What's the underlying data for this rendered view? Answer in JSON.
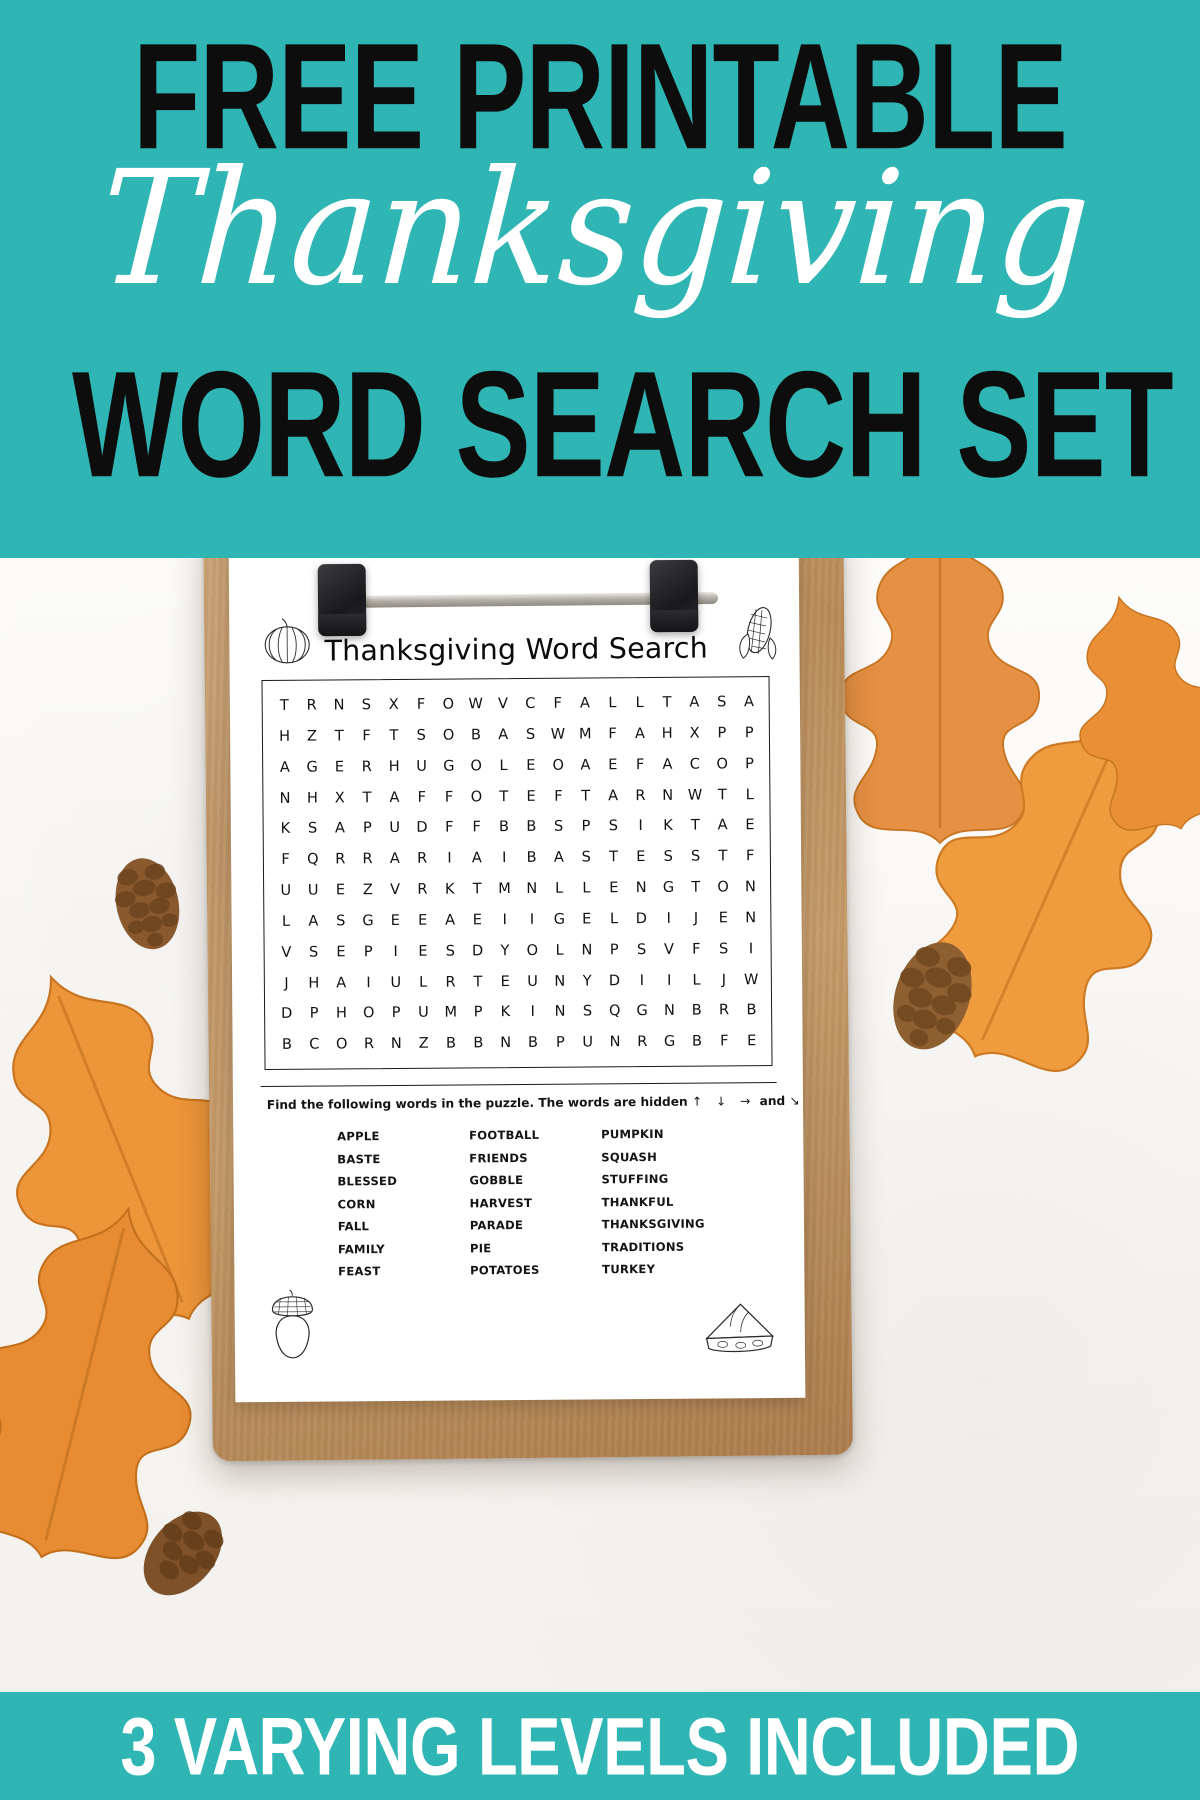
{
  "header": {
    "line1": "FREE PRINTABLE",
    "script": "Thanksgiving",
    "line3": "WORD SEARCH SET",
    "bg_color": "#2fb6b4",
    "text_color": "#0d0d0d",
    "script_color": "#ffffff"
  },
  "footer": {
    "text": "3 VARYING LEVELS INCLUDED",
    "bg_color": "#2fb6b4",
    "text_color": "#ffffff"
  },
  "worksheet": {
    "title": "Thanksgiving Word Search",
    "icons": {
      "left": "pumpkin-icon",
      "right": "corn-icon",
      "bottom_left": "acorn-icon",
      "bottom_right": "pie-slice-icon"
    },
    "instructions": {
      "text": "Find the following words in the puzzle. The words are hidden",
      "arrows": "↑  ↓  →",
      "conjunction": "and",
      "last_arrow": "↘"
    },
    "grid": {
      "columns": 15,
      "rows": 12,
      "letters": [
        "T R N S X F O W V C F A L L T",
        "H Z T F T S O B A S W M F A H X P P",
        "A G E R H U G O L E O A E F A C O P",
        "N H X T A F F O T E F T A R N W T L",
        "K S A P U D F F B B S P S I K T A E",
        "F Q R R A R I A I B A S T E S S T F",
        "U U E Z V R K T M N L L E N G T O N",
        "L A S G E E A E I I G E L D I J E N",
        "V S E P I E S D Y O L N P S V F S I",
        "J H A I U L R T E U N Y D I I L J W",
        "D P H O P U M P K I N S Q G N B R B",
        "B C O R N Z B B N B P U N R G B F E"
      ],
      "rows_data": [
        [
          "T",
          "R",
          "N",
          "S",
          "X",
          "F",
          "O",
          "W",
          "V",
          "C",
          "F",
          "A",
          "L",
          "L",
          "T"
        ],
        [
          "H",
          "Z",
          "T",
          "F",
          "T",
          "S",
          "O",
          "B",
          "A",
          "S",
          "W",
          "M",
          "F",
          "A",
          "H"
        ],
        [
          "A",
          "G",
          "E",
          "R",
          "H",
          "U",
          "G",
          "O",
          "L",
          "E",
          "O",
          "A",
          "E",
          "F",
          "A"
        ],
        [
          "N",
          "H",
          "X",
          "T",
          "A",
          "F",
          "F",
          "O",
          "T",
          "E",
          "F",
          "T",
          "A",
          "R",
          "N"
        ],
        [
          "K",
          "S",
          "A",
          "P",
          "U",
          "D",
          "F",
          "F",
          "B",
          "B",
          "S",
          "P",
          "S",
          "I",
          "K"
        ],
        [
          "F",
          "Q",
          "R",
          "R",
          "A",
          "R",
          "I",
          "A",
          "I",
          "B",
          "A",
          "S",
          "T",
          "E",
          "S"
        ],
        [
          "U",
          "U",
          "E",
          "Z",
          "V",
          "R",
          "K",
          "T",
          "M",
          "N",
          "L",
          "L",
          "E",
          "N",
          "G"
        ],
        [
          "L",
          "A",
          "S",
          "G",
          "E",
          "E",
          "A",
          "E",
          "I",
          "I",
          "G",
          "E",
          "L",
          "D",
          "I"
        ],
        [
          "V",
          "S",
          "E",
          "P",
          "I",
          "E",
          "S",
          "D",
          "Y",
          "O",
          "L",
          "N",
          "P",
          "S",
          "V"
        ],
        [
          "J",
          "H",
          "A",
          "I",
          "U",
          "L",
          "R",
          "T",
          "E",
          "U",
          "N",
          "Y",
          "D",
          "I",
          "I"
        ],
        [
          "D",
          "P",
          "H",
          "O",
          "P",
          "U",
          "M",
          "P",
          "K",
          "I",
          "N",
          "S",
          "Q",
          "G",
          "N"
        ],
        [
          "B",
          "C",
          "O",
          "R",
          "N",
          "Z",
          "B",
          "B",
          "N",
          "B",
          "P",
          "U",
          "N",
          "R",
          "G"
        ]
      ],
      "extra_columns": [
        [
          "A",
          "S",
          "A"
        ],
        [
          "X",
          "P",
          "P"
        ],
        [
          "C",
          "O",
          "P"
        ],
        [
          "W",
          "T",
          "L"
        ],
        [
          "T",
          "A",
          "E"
        ],
        [
          "S",
          "T",
          "F"
        ],
        [
          "T",
          "O",
          "N"
        ],
        [
          "J",
          "E",
          "N"
        ],
        [
          "F",
          "S",
          "I"
        ],
        [
          "L",
          "J",
          "W"
        ],
        [
          "B",
          "R",
          "B"
        ],
        [
          "B",
          "F",
          "E"
        ]
      ]
    },
    "words": {
      "column1": [
        "APPLE",
        "BASTE",
        "BLESSED",
        "CORN",
        "FALL",
        "FAMILY",
        "FEAST"
      ],
      "column2": [
        "FOOTBALL",
        "FRIENDS",
        "GOBBLE",
        "HARVEST",
        "PARADE",
        "PIE",
        "POTATOES"
      ],
      "column3": [
        "PUMPKIN",
        "SQUASH",
        "STUFFING",
        "THANKFUL",
        "THANKSGIVING",
        "TRADITIONS",
        "TURKEY"
      ]
    }
  },
  "decor": {
    "leaves": [
      "oak-leaf",
      "oak-leaf",
      "oak-leaf",
      "oak-leaf",
      "oak-leaf"
    ],
    "pinecones": [
      "pinecone",
      "pinecone",
      "pinecone"
    ],
    "leaf_color": "#e08a2e",
    "clipboard_color": "#b88a57"
  }
}
